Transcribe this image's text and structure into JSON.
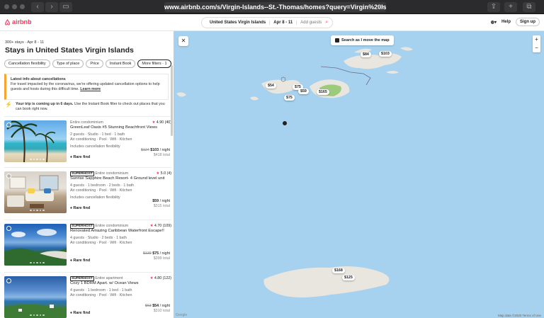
{
  "browser": {
    "url": "www.airbnb.com/s/Virgin-Islands--St.-Thomas/homes?query=Virgin%20Islands%20",
    "back_icon": "chevron-left",
    "forward_icon": "chevron-right"
  },
  "header": {
    "logo": "airbnb",
    "location": "United States Virgin Islands",
    "dates": "Apr 8 - 11",
    "guests_placeholder": "Add guests",
    "help": "Help",
    "signup": "Sign up"
  },
  "results": {
    "meta": "300+ stays · Apr 8 - 11",
    "title": "Stays in United States Virgin Islands",
    "filters": [
      "Cancellation flexibility",
      "Type of place",
      "Price",
      "Instant Book",
      "More filters · 1"
    ],
    "notice_title": "Latest info about cancellations",
    "notice_body": "For travel impacted by the coronavirus, we're offering updated cancellation options to help guests and hosts during this difficult time.",
    "notice_link": "Learn more",
    "trip_text": "Your trip is coming up in 6 days.",
    "trip_text2": "Use the Instant Book filter to check out places that you can book right now."
  },
  "listings": [
    {
      "superhost": "",
      "type": "Entire condominium",
      "rating": "4.90",
      "reviews": "(40)",
      "title": "GreenLeaf Oasis #5 Stunning Beachfront Views",
      "details": "2 guests · Studio · 1 bed · 1 bath",
      "amenities": "Air conditioning · Pool · Wifi · Kitchen",
      "extra": "Includes cancellation flexibility",
      "old_price": "$124",
      "price": "$103",
      "per": "/ night",
      "total": "$418 total",
      "badge": "Rare find"
    },
    {
      "superhost": "SUPERHOST",
      "type": "Entire condominium",
      "rating": "5.0",
      "reviews": "(4)",
      "title": "Sunrise Sapphire Beach Resort- 4 Ground level unit",
      "details": "4 guests · 1 bedroom · 2 beds · 1 bath",
      "amenities": "Air conditioning · Pool · Wifi · Kitchen",
      "extra": "Includes cancellation flexibility",
      "old_price": "",
      "price": "$59",
      "per": "/ night",
      "total": "$315 total",
      "badge": "Rare find"
    },
    {
      "superhost": "SUPERHOST",
      "type": "Entire condominium",
      "rating": "4.70",
      "reviews": "(109)",
      "title": "Renovated Amazing Caribbean Waterfront Escape!!",
      "details": "4 guests · Studio · 2 beds · 1 bath",
      "amenities": "Air conditioning · Pool · Wifi · Kitchen",
      "extra": "",
      "old_price": "$139",
      "price": "$75",
      "per": "/ night",
      "total": "$399 total",
      "badge": "Rare find"
    },
    {
      "superhost": "SUPERHOST",
      "type": "Entire apartment",
      "rating": "4.80",
      "reviews": "(122)",
      "title": "Cozy 1 BDRM Apart. w/ Ocean Views",
      "details": "4 guests · 1 bedroom · 1 bed · 1 bath",
      "amenities": "Air conditioning · Pool · Wifi · Kitchen",
      "extra": "",
      "old_price": "$63",
      "price": "$54",
      "per": "/ night",
      "total": "$310 total",
      "badge": "Rare find"
    }
  ],
  "map": {
    "search_move": "Search as I move the map",
    "zoom_in": "+",
    "zoom_out": "−",
    "pins": [
      "$84",
      "$103",
      "$54",
      "$75",
      "$59",
      "$165",
      "$75",
      "$168",
      "$125"
    ],
    "attribution": "Map data ©2020  Terms of Use",
    "google": "Google"
  },
  "colors": {
    "brand": "#ff385c",
    "sea": "#a6d2ef",
    "land": "#e9e6df",
    "park": "#9ccc7b"
  }
}
